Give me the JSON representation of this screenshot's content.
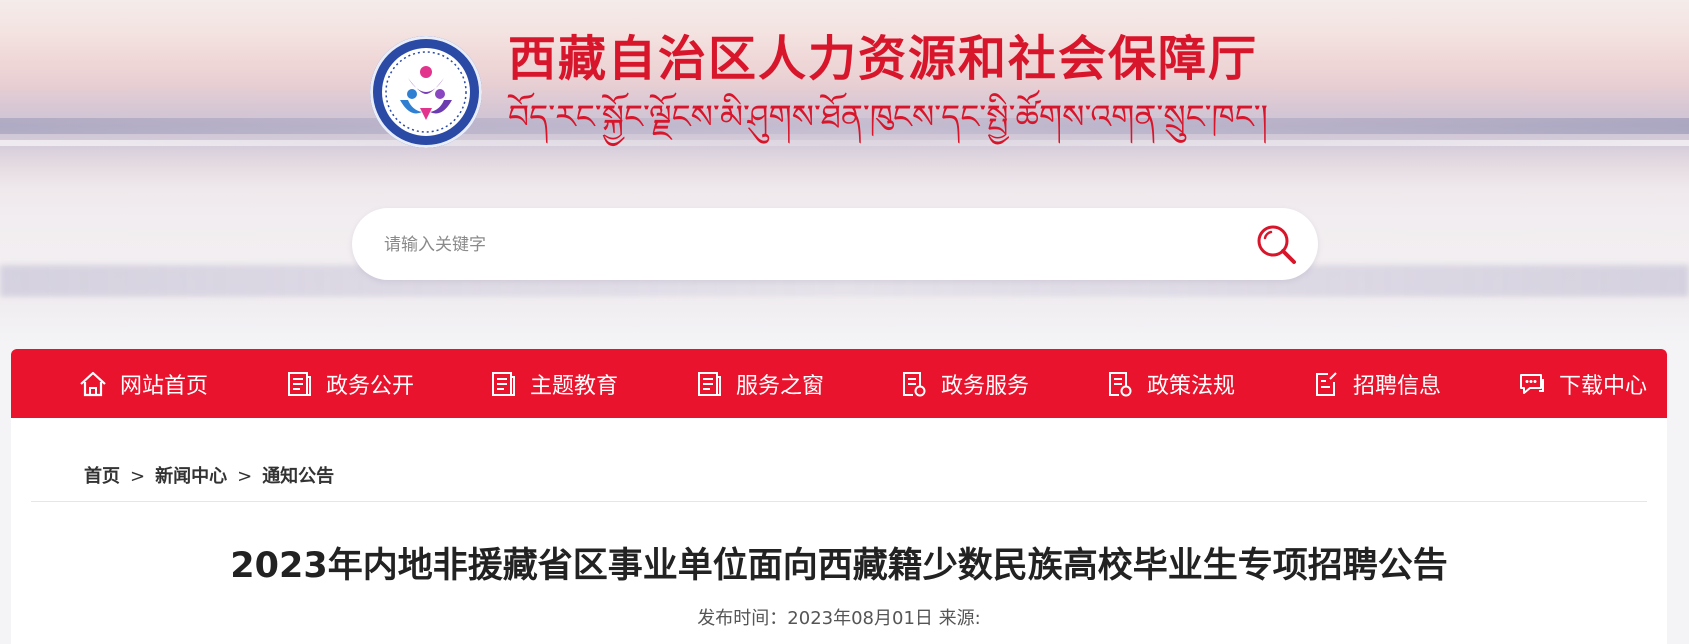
{
  "header": {
    "title_cn": "西藏自治区人力资源和社会保障厅",
    "title_bo": "བོད་རང་སྐྱོང་ལྗོངས་མི་ཤུགས་ཐོན་ཁུངས་དང་སྤྱི་ཚོགས་འགན་སྲུང་ཁང་།"
  },
  "search": {
    "placeholder": "请输入关键字",
    "value": ""
  },
  "nav": {
    "items": [
      {
        "label": "网站首页",
        "icon": "home-icon"
      },
      {
        "label": "政务公开",
        "icon": "document-icon"
      },
      {
        "label": "主题教育",
        "icon": "document-icon"
      },
      {
        "label": "服务之窗",
        "icon": "document-icon"
      },
      {
        "label": "政务服务",
        "icon": "service-doc-icon"
      },
      {
        "label": "政策法规",
        "icon": "service-doc-icon"
      },
      {
        "label": "招聘信息",
        "icon": "edit-doc-icon"
      },
      {
        "label": "下载中心",
        "icon": "chat-icon"
      }
    ]
  },
  "breadcrumb": {
    "items": [
      "首页",
      "新闻中心",
      "通知公告"
    ],
    "separator": ">"
  },
  "article": {
    "title": "2023年内地非援藏省区事业单位面向西藏籍少数民族高校毕业生专项招聘公告",
    "meta": "发布时间：2023年08月01日 来源:"
  },
  "colors": {
    "brand_red": "#e9132d",
    "title_red": "#d8162b",
    "logo_blue": "#2b4aa6"
  }
}
